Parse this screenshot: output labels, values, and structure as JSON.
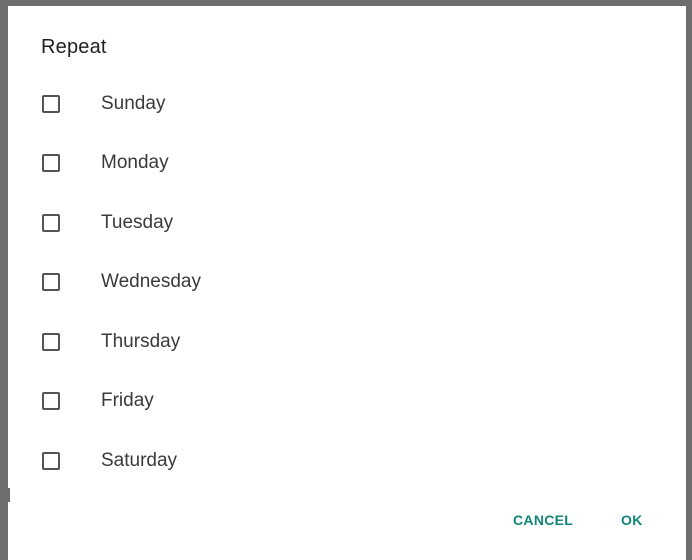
{
  "dialog": {
    "title": "Repeat",
    "days": [
      {
        "label": "Sunday",
        "checked": false
      },
      {
        "label": "Monday",
        "checked": false
      },
      {
        "label": "Tuesday",
        "checked": false
      },
      {
        "label": "Wednesday",
        "checked": false
      },
      {
        "label": "Thursday",
        "checked": false
      },
      {
        "label": "Friday",
        "checked": false
      },
      {
        "label": "Saturday",
        "checked": false
      }
    ],
    "buttons": {
      "cancel": "CANCEL",
      "ok": "OK"
    }
  },
  "colors": {
    "accent": "#128578",
    "frame": "#6e6e6e",
    "text": "#3a3a3a",
    "checkbox_border": "#545454"
  }
}
